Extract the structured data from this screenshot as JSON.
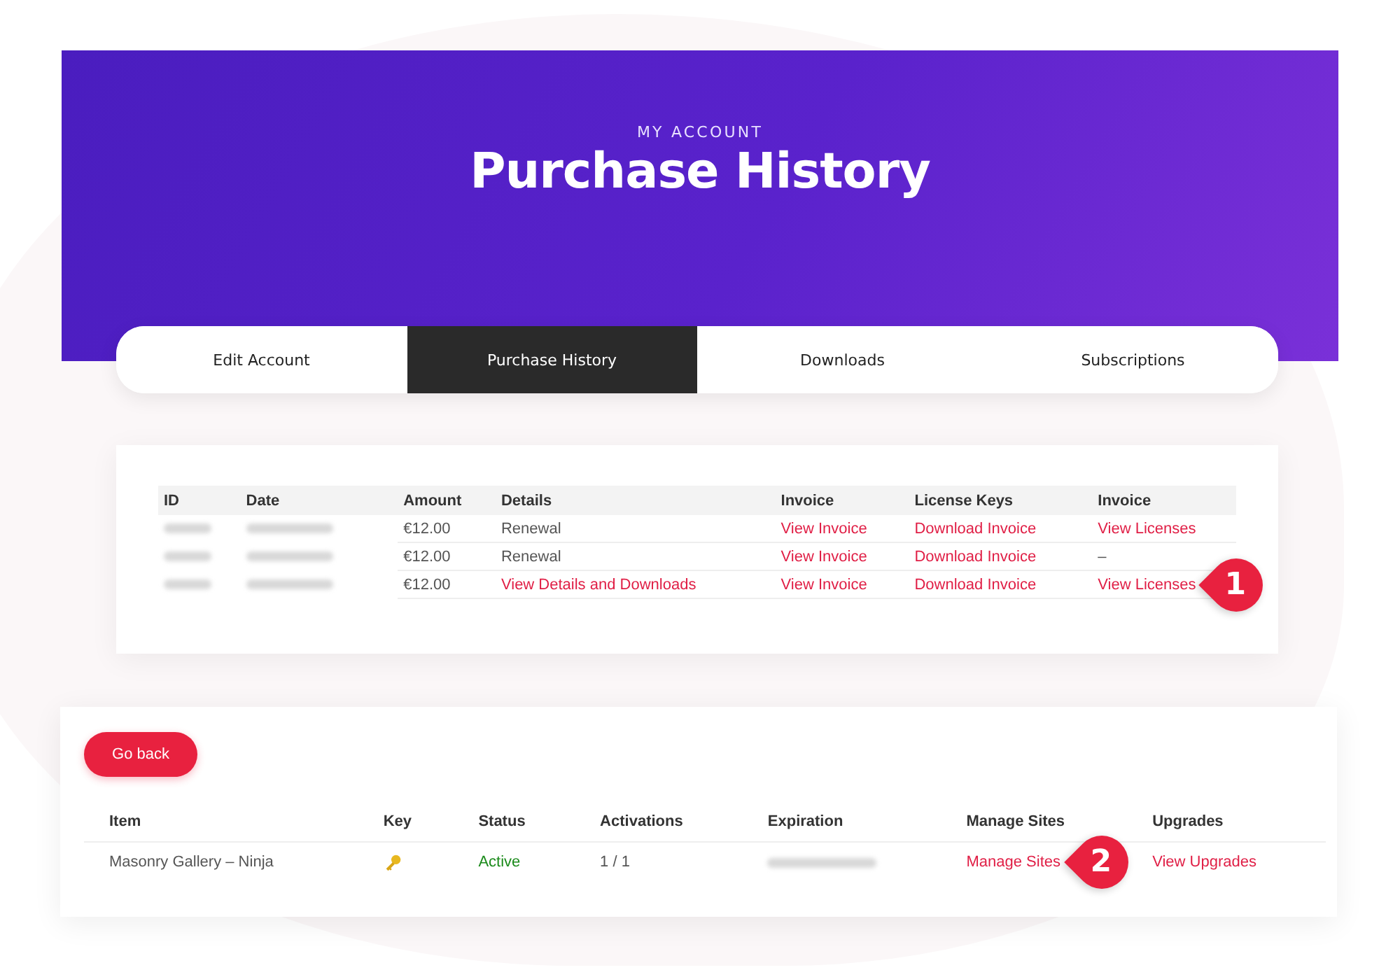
{
  "header": {
    "eyebrow": "MY ACCOUNT",
    "title": "Purchase History"
  },
  "tabs": [
    {
      "label": "Edit Account",
      "selected": false
    },
    {
      "label": "Purchase History",
      "selected": true
    },
    {
      "label": "Downloads",
      "selected": false
    },
    {
      "label": "Subscriptions",
      "selected": false
    }
  ],
  "purchases": {
    "columns": [
      "ID",
      "Date",
      "Amount",
      "Details",
      "Invoice",
      "License Keys",
      "Invoice"
    ],
    "rows": [
      {
        "cells": [
          {
            "kind": "redacted"
          },
          {
            "kind": "redacted"
          },
          {
            "kind": "text",
            "text": "€12.00"
          },
          {
            "kind": "text",
            "text": "Renewal"
          },
          {
            "kind": "link",
            "text": "View Invoice"
          },
          {
            "kind": "link",
            "text": "Download Invoice"
          },
          {
            "kind": "link",
            "text": "View Licenses"
          }
        ]
      },
      {
        "cells": [
          {
            "kind": "redacted"
          },
          {
            "kind": "redacted"
          },
          {
            "kind": "text",
            "text": "€12.00"
          },
          {
            "kind": "text",
            "text": "Renewal"
          },
          {
            "kind": "link",
            "text": "View Invoice"
          },
          {
            "kind": "link",
            "text": "Download Invoice"
          },
          {
            "kind": "text",
            "text": "–"
          }
        ]
      },
      {
        "cells": [
          {
            "kind": "redacted"
          },
          {
            "kind": "redacted"
          },
          {
            "kind": "text",
            "text": "€12.00"
          },
          {
            "kind": "link",
            "text": "View Details and Downloads"
          },
          {
            "kind": "link",
            "text": "View Invoice"
          },
          {
            "kind": "link",
            "text": "Download Invoice"
          },
          {
            "kind": "link",
            "text": "View Licenses",
            "callout": "1"
          }
        ]
      }
    ]
  },
  "back_button": "Go back",
  "licenses": {
    "columns": [
      "Item",
      "Key",
      "Status",
      "Activations",
      "Expiration",
      "Manage Sites",
      "Upgrades"
    ],
    "rows": [
      {
        "cells": [
          {
            "kind": "text",
            "text": "Masonry Gallery – Ninja"
          },
          {
            "kind": "key"
          },
          {
            "kind": "status",
            "text": "Active"
          },
          {
            "kind": "text",
            "text": "1 / 1"
          },
          {
            "kind": "redacted"
          },
          {
            "kind": "link",
            "text": "Manage Sites",
            "callout": "2"
          },
          {
            "kind": "link",
            "text": "View Upgrades"
          }
        ]
      }
    ]
  }
}
